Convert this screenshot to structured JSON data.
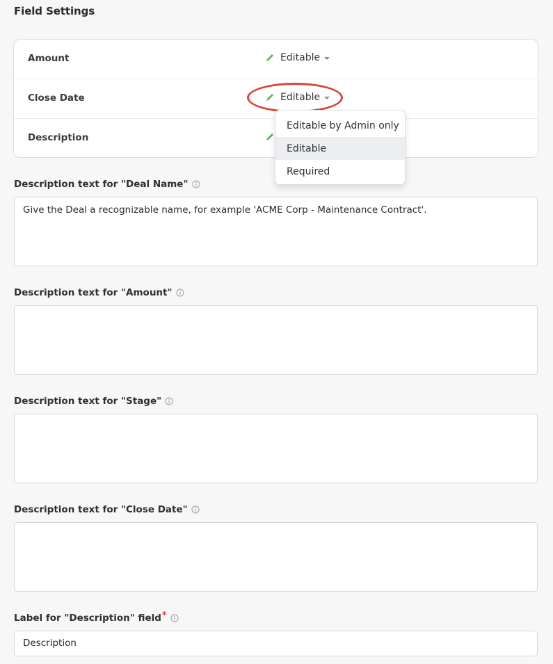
{
  "section": {
    "title": "Field Settings"
  },
  "fields": [
    {
      "name": "Amount",
      "access": "Editable"
    },
    {
      "name": "Close Date",
      "access": "Editable"
    },
    {
      "name": "Description",
      "access": ""
    }
  ],
  "dropdown": {
    "options": [
      "Editable by Admin only",
      "Editable",
      "Required"
    ],
    "selected": "Editable"
  },
  "descriptions": [
    {
      "label": "Description text for \"Deal Name\"",
      "value": "Give the Deal a recognizable name, for example 'ACME Corp - Maintenance Contract'."
    },
    {
      "label": "Description text for \"Amount\"",
      "value": ""
    },
    {
      "label": "Description text for \"Stage\"",
      "value": ""
    },
    {
      "label": "Description text for \"Close Date\"",
      "value": ""
    }
  ],
  "description_label_field": {
    "label": "Label for \"Description\" field",
    "required_mark": "*",
    "value": "Description"
  },
  "colors": {
    "pencil": "#5cb85c",
    "highlight": "#d9473a",
    "required": "#d9473a"
  },
  "icons": {
    "edit": "pencil-icon",
    "info": "info-circle-icon",
    "dropdown": "caret-down-icon"
  }
}
